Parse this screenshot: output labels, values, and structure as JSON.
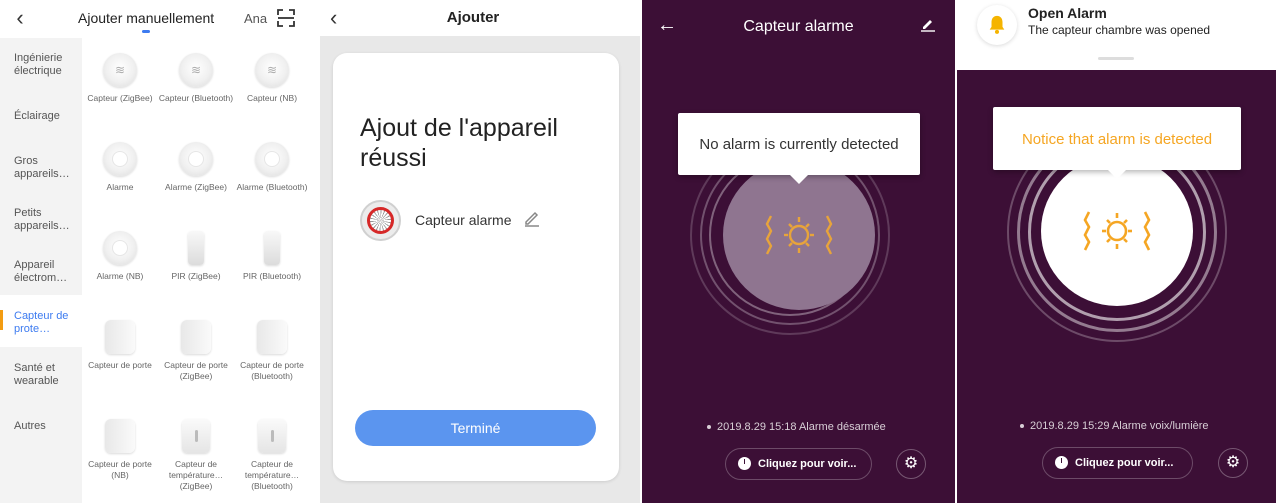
{
  "panel1": {
    "tab_title": "Ajouter manuellement",
    "tab_other": "Ana",
    "categories": [
      "Ingénierie électrique",
      "Éclairage",
      "Gros appareils…",
      "Petits appareils…",
      "Appareil électrom…",
      "Capteur de prote…",
      "Santé et wearable",
      "Autres"
    ],
    "active_category": "Capteur de prote…",
    "devices": [
      "Capteur (ZigBee)",
      "Capteur (Bluetooth)",
      "Capteur (NB)",
      "Alarme",
      "Alarme (ZigBee)",
      "Alarme (Bluetooth)",
      "Alarme (NB)",
      "PIR (ZigBee)",
      "PIR (Bluetooth)",
      "Capteur de porte",
      "Capteur de porte (ZigBee)",
      "Capteur de porte (Bluetooth)",
      "Capteur de porte (NB)",
      "Capteur de température… (ZigBee)",
      "Capteur de température… (Bluetooth)"
    ]
  },
  "panel2": {
    "title": "Ajouter",
    "success": "Ajout de l'appareil réussi",
    "device_name": "Capteur alarme",
    "done_button": "Terminé"
  },
  "panel3": {
    "title": "Capteur alarme",
    "tooltip": "No alarm is currently detected",
    "event": "2019.8.29 15:18 Alarme désarmée",
    "button": "Cliquez pour voir..."
  },
  "panel4": {
    "notif_title": "Open Alarm",
    "notif_body": "The capteur chambre was opened",
    "tooltip": "Notice that alarm is detected",
    "event": "2019.8.29 15:29 Alarme voix/lumière",
    "button": "Cliquez pour voir..."
  },
  "colors": {
    "accent_blue": "#3d7bf0",
    "sidebar_marker": "#f39c12",
    "dark_bg": "#3c0f36",
    "alarm_orange": "#f5a623",
    "button_blue": "#5b95ef"
  },
  "icons": [
    "back-icon",
    "scan-icon",
    "edit-icon",
    "pencil-icon",
    "bell-icon",
    "clock-icon",
    "gear-icon",
    "alarm-light-icon"
  ]
}
